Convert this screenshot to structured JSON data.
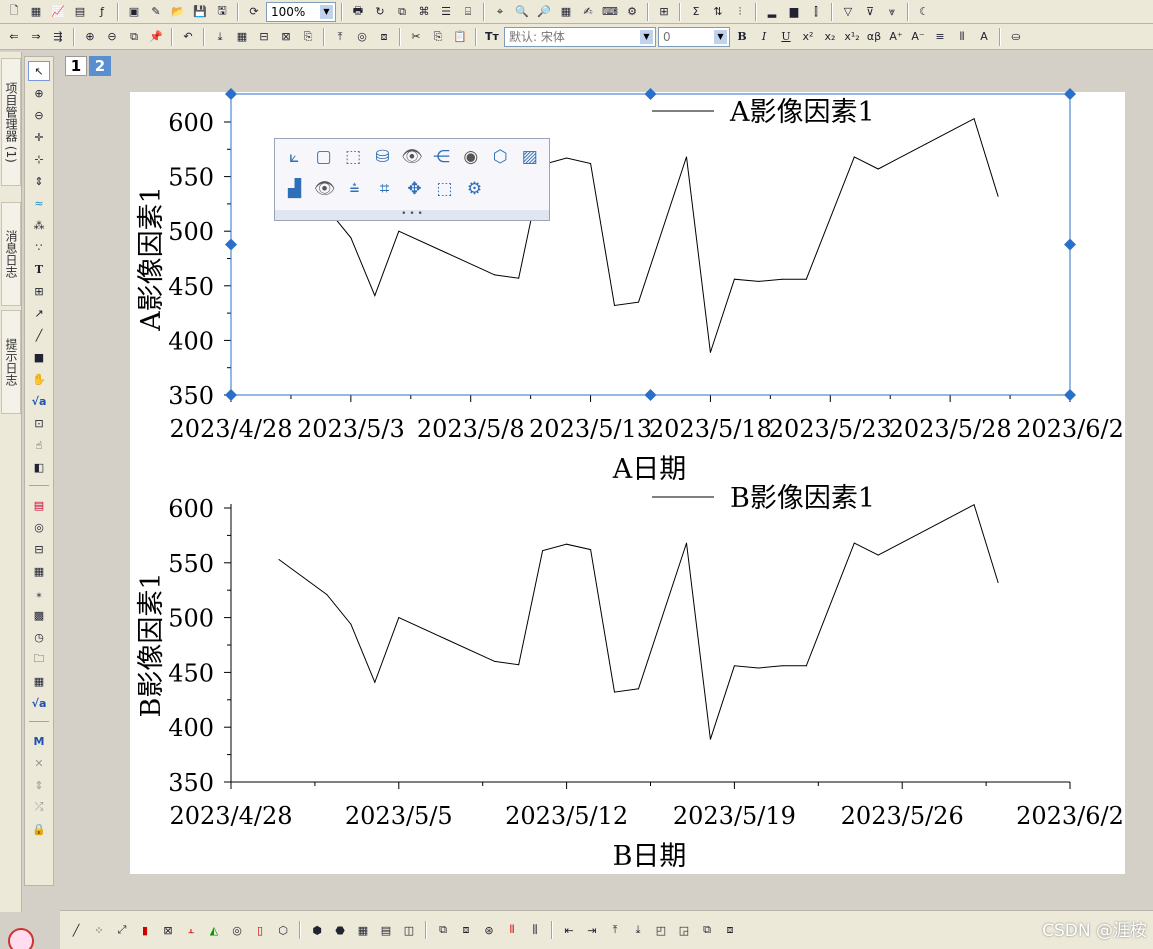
{
  "toolbar_top": {
    "zoom_value": "100%"
  },
  "toolbar_format": {
    "font_name": "默认: 宋体",
    "font_size": "0",
    "bold_label": "B",
    "italic_label": "I",
    "underline_label": "U",
    "greek_label": "αβ"
  },
  "left_panel": {
    "tabs": [
      "项目管理器 (1)",
      "消息日志",
      "提示日志"
    ]
  },
  "page_tabs": [
    "1",
    "2"
  ],
  "watermark": "CSDN @涯桉",
  "icons": {
    "pointer": "pointer-icon",
    "zoom": "zoom-icon",
    "text_tool": "text-tool-icon",
    "sqrt": "sqrt-icon"
  },
  "colors": {
    "selection": "#2a6fc9",
    "frame_accent": "#e8a33a",
    "line": "#000000"
  },
  "chart_data": [
    {
      "type": "line",
      "xlabel": "A日期",
      "ylabel": "A影像因素1",
      "legend": "A影像因素1",
      "legend_position": "top-right",
      "ylim": [
        350,
        600
      ],
      "yticks": [
        350,
        400,
        450,
        500,
        550,
        600
      ],
      "xticks": [
        "2023/4/28",
        "2023/5/3",
        "2023/5/8",
        "2023/5/13",
        "2023/5/18",
        "2023/5/23",
        "2023/5/28",
        "2023/6/2"
      ],
      "grid": false,
      "x": [
        "2023/4/30",
        "2023/5/2",
        "2023/5/3",
        "2023/5/4",
        "2023/5/5",
        "2023/5/7",
        "2023/5/9",
        "2023/5/10",
        "2023/5/11",
        "2023/5/12",
        "2023/5/13",
        "2023/5/14",
        "2023/5/15",
        "2023/5/17",
        "2023/5/18",
        "2023/5/19",
        "2023/5/20",
        "2023/5/21",
        "2023/5/22",
        "2023/5/24",
        "2023/5/25",
        "2023/5/27",
        "2023/5/29",
        "2023/5/30"
      ],
      "values": [
        553,
        521,
        494,
        441,
        500,
        480,
        460,
        457,
        561,
        567,
        562,
        432,
        435,
        568,
        389,
        456,
        454,
        456,
        456,
        568,
        557,
        580,
        603,
        532
      ]
    },
    {
      "type": "line",
      "xlabel": "B日期",
      "ylabel": "B影像因素1",
      "legend": "B影像因素1",
      "legend_position": "top-right",
      "ylim": [
        350,
        600
      ],
      "yticks": [
        350,
        400,
        450,
        500,
        550,
        600
      ],
      "xticks": [
        "2023/4/28",
        "2023/5/5",
        "2023/5/12",
        "2023/5/19",
        "2023/5/26",
        "2023/6/2"
      ],
      "grid": false,
      "x": [
        "2023/4/30",
        "2023/5/2",
        "2023/5/3",
        "2023/5/4",
        "2023/5/5",
        "2023/5/7",
        "2023/5/9",
        "2023/5/10",
        "2023/5/11",
        "2023/5/12",
        "2023/5/13",
        "2023/5/14",
        "2023/5/15",
        "2023/5/17",
        "2023/5/18",
        "2023/5/19",
        "2023/5/20",
        "2023/5/21",
        "2023/5/22",
        "2023/5/24",
        "2023/5/25",
        "2023/5/27",
        "2023/5/29",
        "2023/5/30"
      ],
      "values": [
        553,
        521,
        494,
        441,
        500,
        480,
        460,
        457,
        561,
        567,
        562,
        432,
        435,
        568,
        389,
        456,
        454,
        456,
        456,
        568,
        557,
        580,
        603,
        532
      ]
    }
  ]
}
